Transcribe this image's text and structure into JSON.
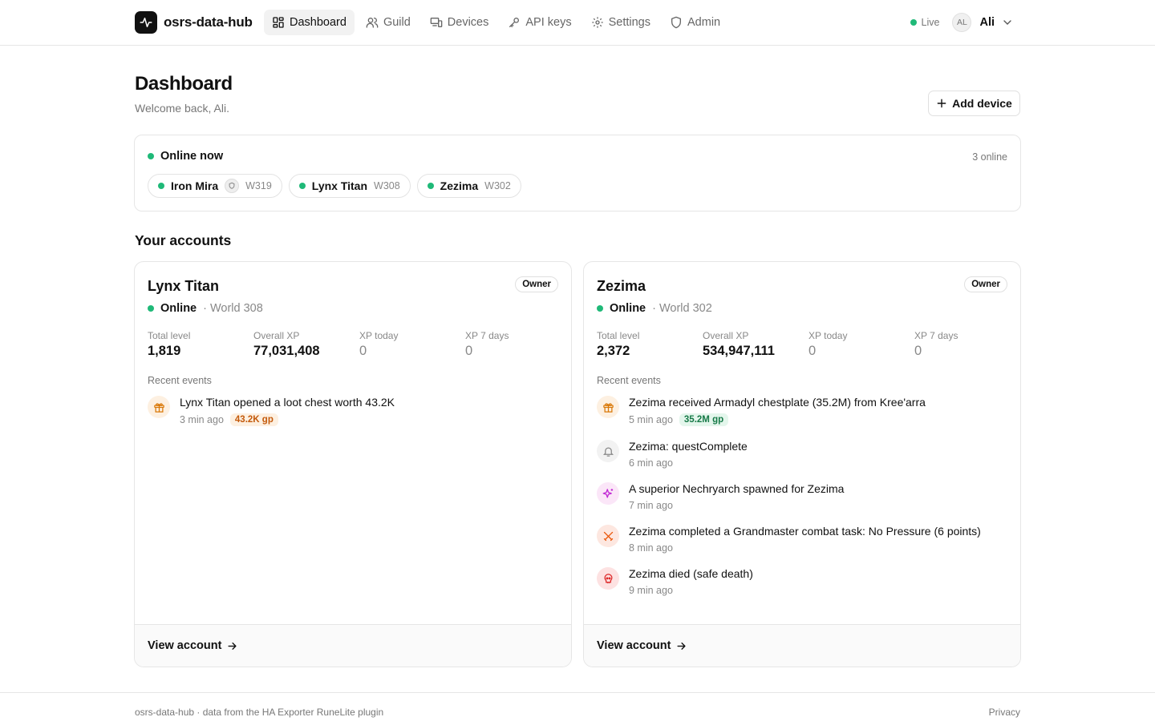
{
  "brand": {
    "name": "osrs-data-hub",
    "logo_icon": "activity-icon"
  },
  "nav": [
    {
      "label": "Dashboard",
      "icon": "dashboard-icon",
      "active": true
    },
    {
      "label": "Guild",
      "icon": "users-icon"
    },
    {
      "label": "Devices",
      "icon": "devices-icon"
    },
    {
      "label": "API keys",
      "icon": "key-icon"
    },
    {
      "label": "Settings",
      "icon": "gear-icon"
    },
    {
      "label": "Admin",
      "icon": "shield-icon"
    }
  ],
  "status": {
    "live_label": "Live",
    "live_color": "#1fb978"
  },
  "user": {
    "initials": "AL",
    "name": "Ali"
  },
  "page": {
    "title": "Dashboard",
    "subtitle": "Welcome back, Ali."
  },
  "add_device_label": "Add device",
  "online_now": {
    "title": "Online now",
    "count_label": "3 online",
    "players": [
      {
        "name": "Iron Mira",
        "world": "W319",
        "ironman_badge": true
      },
      {
        "name": "Lynx Titan",
        "world": "W308"
      },
      {
        "name": "Zezima",
        "world": "W302"
      }
    ]
  },
  "accounts_section_title": "Your accounts",
  "accounts": [
    {
      "name": "Lynx Titan",
      "role": "Owner",
      "status": "Online",
      "world": "· World 308",
      "stats": [
        {
          "label": "Total level",
          "value": "1,819"
        },
        {
          "label": "Overall XP",
          "value": "77,031,408"
        },
        {
          "label": "XP today",
          "value": "0"
        },
        {
          "label": "XP 7 days",
          "value": "0"
        }
      ],
      "events_title": "Recent events",
      "events": [
        {
          "icon": "gift-icon",
          "text": "Lynx Titan opened a loot chest worth 43.2K",
          "time": "3 min ago",
          "badge": "43.2K gp",
          "badge_color": "orange"
        }
      ],
      "footer_label": "View account"
    },
    {
      "name": "Zezima",
      "role": "Owner",
      "status": "Online",
      "world": "· World 302",
      "stats": [
        {
          "label": "Total level",
          "value": "2,372"
        },
        {
          "label": "Overall XP",
          "value": "534,947,111"
        },
        {
          "label": "XP today",
          "value": "0"
        },
        {
          "label": "XP 7 days",
          "value": "0"
        }
      ],
      "events_title": "Recent events",
      "events": [
        {
          "icon": "gift-icon",
          "text": "Zezima received Armadyl chestplate (35.2M) from Kree'arra",
          "time": "5 min ago",
          "badge": "35.2M gp",
          "badge_color": "green"
        },
        {
          "icon": "bell-icon",
          "text": "Zezima: questComplete",
          "time": "6 min ago"
        },
        {
          "icon": "sparkles-icon",
          "text": "A superior Nechryarch spawned for Zezima",
          "time": "7 min ago"
        },
        {
          "icon": "swords-icon",
          "text": "Zezima completed a Grandmaster combat task: No Pressure (6 points)",
          "time": "8 min ago"
        },
        {
          "icon": "skull-icon",
          "text": "Zezima died (safe death)",
          "time": "9 min ago"
        }
      ],
      "footer_label": "View account"
    }
  ],
  "footer": {
    "left": "osrs-data-hub · data from the HA Exporter RuneLite plugin",
    "right": "Privacy"
  }
}
